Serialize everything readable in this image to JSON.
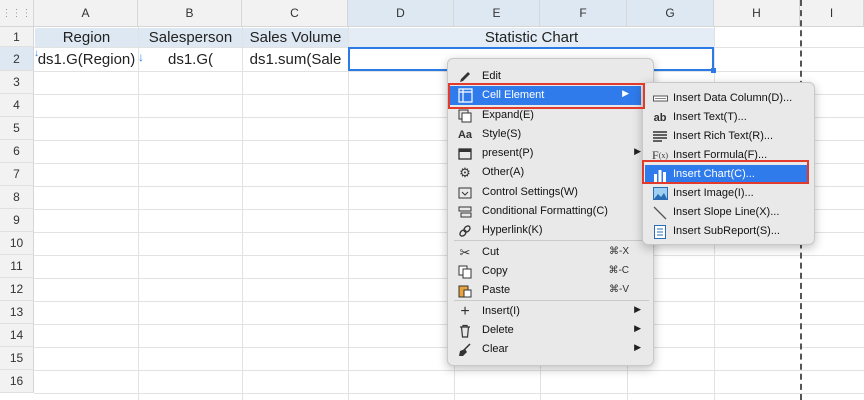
{
  "columns": [
    "A",
    "B",
    "C",
    "D",
    "E",
    "F",
    "G",
    "H",
    "I"
  ],
  "rows": [
    "1",
    "2",
    "3",
    "4",
    "5",
    "6",
    "7",
    "8",
    "9",
    "10",
    "11",
    "12",
    "13",
    "14",
    "15",
    "16"
  ],
  "cells": {
    "a1": "Region",
    "b1": "Salesperson",
    "c1": "Sales Volume",
    "d1": "Statistic Chart",
    "a2": "ds1.G(Region)",
    "b2": "ds1.G(",
    "c2": "ds1.sum(Sale"
  },
  "context_menu": {
    "items": [
      {
        "label": "Edit",
        "icon": "pencil-icon"
      },
      {
        "label": "Cell Element",
        "icon": "cell-element-icon",
        "submenu": true
      },
      {
        "label": "Expand(E)",
        "icon": "expand-icon"
      },
      {
        "label": "Style(S)",
        "icon": "style-icon"
      },
      {
        "label": "present(P)",
        "icon": "present-icon",
        "submenu": true
      },
      {
        "label": "Other(A)",
        "icon": "gear-icon"
      },
      {
        "label": "Control Settings(W)",
        "icon": "control-settings-icon"
      },
      {
        "label": "Conditional Formatting(C)",
        "icon": "conditional-formatting-icon"
      },
      {
        "label": "Hyperlink(K)",
        "icon": "link-icon"
      },
      {
        "label": "Cut",
        "icon": "scissors-icon",
        "shortcut": "⌘-X"
      },
      {
        "label": "Copy",
        "icon": "copy-icon",
        "shortcut": "⌘-C"
      },
      {
        "label": "Paste",
        "icon": "paste-icon",
        "shortcut": "⌘-V"
      },
      {
        "label": "Insert(I)",
        "icon": "plus-icon",
        "submenu": true
      },
      {
        "label": "Delete",
        "icon": "trash-icon",
        "submenu": true
      },
      {
        "label": "Clear",
        "icon": "broom-icon",
        "submenu": true
      }
    ]
  },
  "submenu": {
    "items": [
      {
        "label": "Insert Data Column(D)...",
        "icon": "data-column-icon"
      },
      {
        "label": "Insert Text(T)...",
        "icon": "text-ab-icon"
      },
      {
        "label": "Insert Rich Text(R)...",
        "icon": "rich-text-icon"
      },
      {
        "label": "Insert Formula(F)...",
        "icon": "formula-icon"
      },
      {
        "label": "Insert Chart(C)...",
        "icon": "bar-chart-icon"
      },
      {
        "label": "Insert Image(I)...",
        "icon": "image-icon"
      },
      {
        "label": "Insert Slope Line(X)...",
        "icon": "slope-line-icon"
      },
      {
        "label": "Insert SubReport(S)...",
        "icon": "subreport-icon"
      }
    ]
  },
  "colors": {
    "accent": "#2f7bec",
    "highlight_box": "#e23b2e",
    "header_fill": "#dde8f3"
  }
}
